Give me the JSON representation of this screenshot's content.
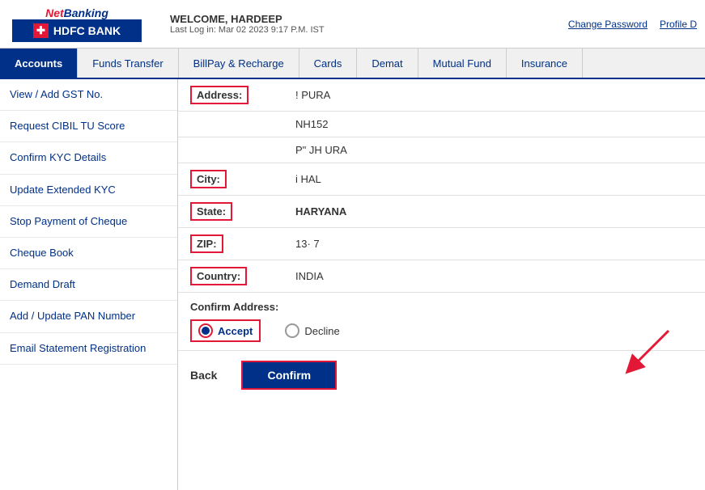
{
  "header": {
    "netbanking_label": "NetBanking",
    "bank_name": "HDFC BANK",
    "welcome_text": "WELCOME, HARDEEP",
    "last_login": "Last Log in: Mar 02 2023 9:17 P.M. IST",
    "change_password": "Change Password",
    "profile": "Profile D"
  },
  "nav": {
    "tabs": [
      {
        "label": "Accounts",
        "active": true
      },
      {
        "label": "Funds Transfer",
        "active": false
      },
      {
        "label": "BillPay & Recharge",
        "active": false
      },
      {
        "label": "Cards",
        "active": false
      },
      {
        "label": "Demat",
        "active": false
      },
      {
        "label": "Mutual Fund",
        "active": false
      },
      {
        "label": "Insurance",
        "active": false
      }
    ]
  },
  "sidebar": {
    "items": [
      {
        "label": "View / Add GST No."
      },
      {
        "label": "Request CIBIL TU Score"
      },
      {
        "label": "Confirm KYC Details"
      },
      {
        "label": "Update Extended KYC"
      },
      {
        "label": "Stop Payment of Cheque"
      },
      {
        "label": "Cheque Book"
      },
      {
        "label": "Demand Draft"
      },
      {
        "label": "Add / Update PAN Number"
      },
      {
        "label": "Email Statement Registration"
      }
    ]
  },
  "form": {
    "fields": [
      {
        "label": "Address:",
        "value": "! PURA",
        "value_class": "normal"
      },
      {
        "label": "",
        "value": "NH152",
        "value_class": "normal"
      },
      {
        "label": "",
        "value": "P\" JH URA",
        "value_class": "normal"
      },
      {
        "label": "City:",
        "value": "i HAL",
        "value_class": "normal"
      },
      {
        "label": "State:",
        "value": "HARYANA",
        "value_class": "bold"
      },
      {
        "label": "ZIP:",
        "value": "13· 7",
        "value_class": "normal"
      },
      {
        "label": "Country:",
        "value": "INDIA",
        "value_class": "normal"
      }
    ],
    "confirm_address_label": "Confirm Address:",
    "accept_label": "Accept",
    "decline_label": "Decline"
  },
  "actions": {
    "back_label": "Back",
    "confirm_label": "Confirm"
  }
}
